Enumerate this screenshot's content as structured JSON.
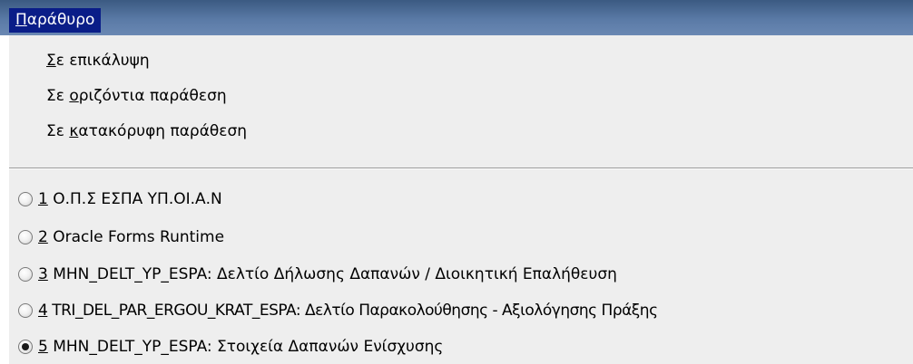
{
  "menu": {
    "title": "Παράθυρο"
  },
  "arrange_items": [
    {
      "mnemonic": "Σ",
      "rest": "ε επικάλυψη"
    },
    {
      "prefix": "Σε ",
      "mnemonic": "ο",
      "rest": "ριζόντια παράθεση"
    },
    {
      "prefix": "Σε ",
      "mnemonic": "κ",
      "rest": "ατακόρυφη παράθεση"
    }
  ],
  "windows": [
    {
      "number": "1",
      "label": " Ο.Π.Σ ΕΣΠΑ ΥΠ.ΟΙ.Α.Ν",
      "selected": false
    },
    {
      "number": "2",
      "label": " Oracle Forms Runtime",
      "selected": false
    },
    {
      "number": "3",
      "label": " MHN_DELT_YP_ESPA: Δελτίο Δήλωσης Δαπανών / Διοικητική Επαλήθευση",
      "selected": false
    },
    {
      "number": "4",
      "label": " TRI_DEL_PAR_ERGOU_KRAT_ESPA: Δελτίο Παρακολούθησης - Αξιολόγησης Πράξης",
      "selected": false
    },
    {
      "number": "5",
      "label": " MHN_DELT_YP_ESPA: Στοιχεία Δαπανών Ενίσχυσης",
      "selected": true
    }
  ]
}
